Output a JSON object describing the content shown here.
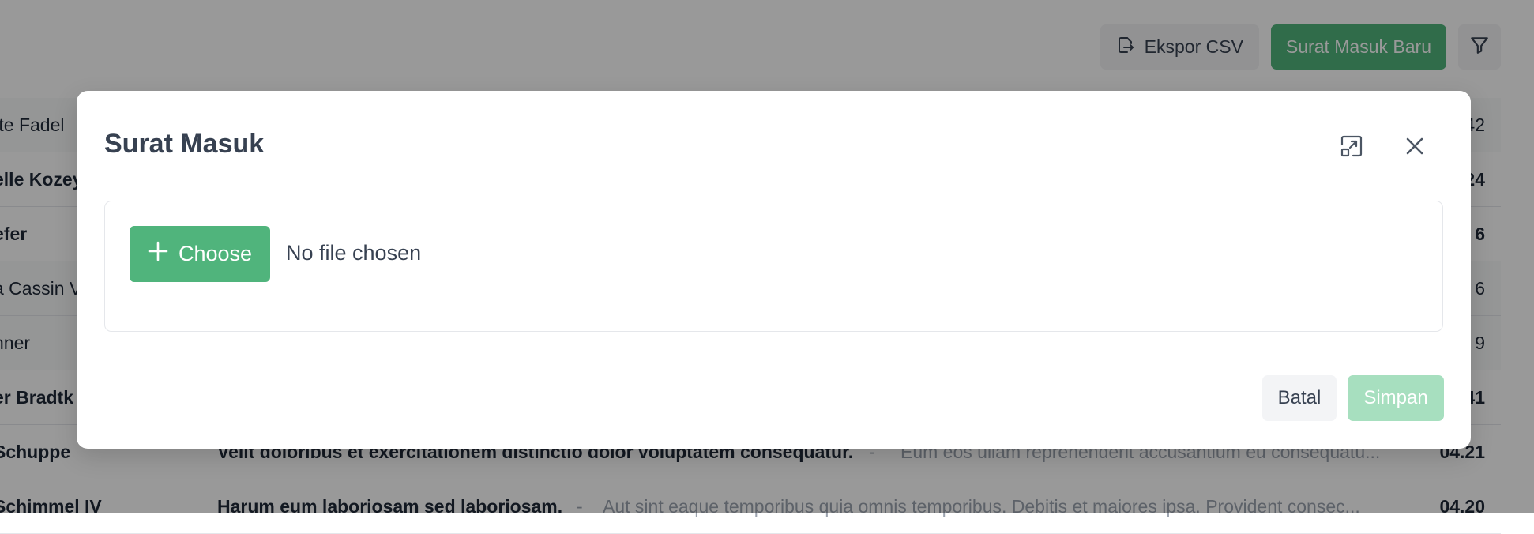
{
  "toolbar": {
    "export_label": "Ekspor CSV",
    "new_label": "Surat Masuk Baru",
    "export_icon": "export-icon",
    "filter_icon": "filter-icon"
  },
  "rows": [
    {
      "sender": "tte Fadel",
      "subject": "",
      "preview": "",
      "time": "42",
      "unread": false
    },
    {
      "sender": "elle Kozey",
      "subject": "",
      "preview": "",
      "time": "24",
      "unread": true
    },
    {
      "sender": "efer",
      "subject": "",
      "preview": "",
      "time": "6",
      "unread": true
    },
    {
      "sender": "a Cassin V",
      "subject": "",
      "preview": "",
      "time": "6",
      "unread": false
    },
    {
      "sender": "nner",
      "subject": "",
      "preview": "",
      "time": "9",
      "unread": false
    },
    {
      "sender": "er Bradtk",
      "subject": "",
      "preview": "",
      "time": "41",
      "unread": true
    },
    {
      "sender": "Schuppe",
      "subject": "Velit doloribus et exercitationem distinctio dolor voluptatem consequatur.",
      "preview": "Eum eos ullam reprehenderit accusantium eu consequatu...",
      "time": "04.21",
      "unread": true
    },
    {
      "sender": "Schimmel IV",
      "subject": "Harum eum laboriosam sed laboriosam.",
      "preview": "Aut sint eaque temporibus quia omnis temporibus. Debitis et maiores ipsa. Provident consec...",
      "time": "04.20",
      "unread": true
    }
  ],
  "modal": {
    "title": "Surat Masuk",
    "choose_label": "Choose",
    "no_file_text": "No file chosen",
    "cancel_label": "Batal",
    "save_label": "Simpan"
  },
  "colors": {
    "accent": "#50b47c",
    "accent_disabled": "#a7dfbf"
  }
}
